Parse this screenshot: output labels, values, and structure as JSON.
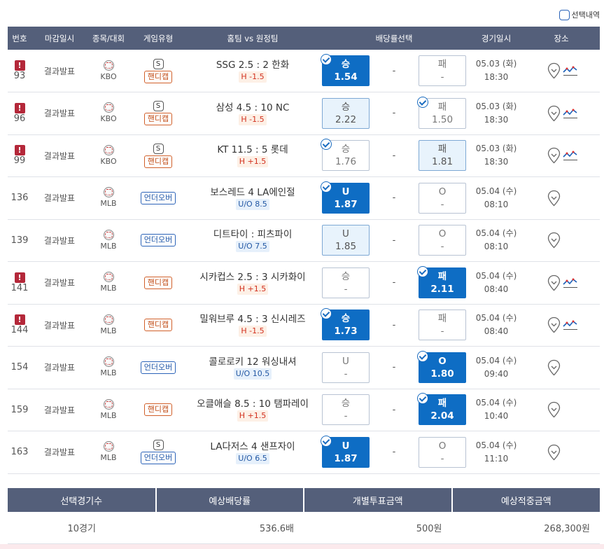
{
  "toggle_label": "선택내역",
  "headers": [
    "번호",
    "마감일시",
    "종목/대회",
    "게임유형",
    "홈팀 vs 원정팀",
    "배당률선택",
    "경기일시",
    "장소"
  ],
  "rows": [
    {
      "warn": "!",
      "num": "93",
      "deadline": "결과발표",
      "league": "KBO",
      "s_badge": "S",
      "type": "핸디캡",
      "type_kind": "handi",
      "home": "SSG 2.5",
      "sep": ":",
      "away": "2 한화",
      "sub": "H -1.5",
      "sub_kind": "red",
      "left": {
        "label": "승",
        "odds": "1.54",
        "state": "sel"
      },
      "mid": "-",
      "right": {
        "label": "패",
        "odds": "-",
        "state": "none"
      },
      "date": "05.03 (화)",
      "time": "18:30",
      "graph": true
    },
    {
      "warn": "!",
      "num": "96",
      "deadline": "결과발표",
      "league": "KBO",
      "s_badge": "S",
      "type": "핸디캡",
      "type_kind": "handi",
      "home": "삼성 4.5",
      "sep": ":",
      "away": "10 NC",
      "sub": "H -1.5",
      "sub_kind": "red",
      "left": {
        "label": "승",
        "odds": "2.22",
        "state": "faint"
      },
      "mid": "-",
      "right": {
        "label": "패",
        "odds": "1.50",
        "state": "chk"
      },
      "date": "05.03 (화)",
      "time": "18:30",
      "graph": true
    },
    {
      "warn": "!",
      "num": "99",
      "deadline": "결과발표",
      "league": "KBO",
      "s_badge": "S",
      "type": "핸디캡",
      "type_kind": "handi",
      "home": "KT 11.5",
      "sep": ":",
      "away": "5 롯데",
      "sub": "H +1.5",
      "sub_kind": "red",
      "left": {
        "label": "승",
        "odds": "1.76",
        "state": "chk"
      },
      "mid": "-",
      "right": {
        "label": "패",
        "odds": "1.81",
        "state": "faint"
      },
      "date": "05.03 (화)",
      "time": "18:30",
      "graph": true
    },
    {
      "warn": "",
      "num": "136",
      "deadline": "결과발표",
      "league": "MLB",
      "s_badge": "",
      "type": "언더오버",
      "type_kind": "uo",
      "home": "보스레드",
      "sep": "4",
      "away": "LA에인절",
      "sub": "U/O 8.5",
      "sub_kind": "blue",
      "left": {
        "label": "U",
        "odds": "1.87",
        "state": "sel"
      },
      "mid": "-",
      "right": {
        "label": "O",
        "odds": "-",
        "state": "none"
      },
      "date": "05.04 (수)",
      "time": "08:10",
      "graph": false
    },
    {
      "warn": "",
      "num": "139",
      "deadline": "결과발표",
      "league": "MLB",
      "s_badge": "",
      "type": "언더오버",
      "type_kind": "uo",
      "home": "디트타이",
      "sep": ":",
      "away": "피츠파이",
      "sub": "U/O 7.5",
      "sub_kind": "blue",
      "left": {
        "label": "U",
        "odds": "1.85",
        "state": "faint"
      },
      "mid": "-",
      "right": {
        "label": "O",
        "odds": "-",
        "state": "none"
      },
      "date": "05.04 (수)",
      "time": "08:10",
      "graph": false
    },
    {
      "warn": "!",
      "num": "141",
      "deadline": "결과발표",
      "league": "MLB",
      "s_badge": "",
      "type": "핸디캡",
      "type_kind": "handi",
      "home": "시카컵스 2.5",
      "sep": ":",
      "away": "3 시카화이",
      "sub": "H +1.5",
      "sub_kind": "red",
      "left": {
        "label": "승",
        "odds": "-",
        "state": "none"
      },
      "mid": "-",
      "right": {
        "label": "패",
        "odds": "2.11",
        "state": "sel"
      },
      "date": "05.04 (수)",
      "time": "08:40",
      "graph": true
    },
    {
      "warn": "!",
      "num": "144",
      "deadline": "결과발표",
      "league": "MLB",
      "s_badge": "",
      "type": "핸디캡",
      "type_kind": "handi",
      "home": "밀워브루 4.5",
      "sep": ":",
      "away": "3 신시레즈",
      "sub": "H -1.5",
      "sub_kind": "red",
      "left": {
        "label": "승",
        "odds": "1.73",
        "state": "sel"
      },
      "mid": "-",
      "right": {
        "label": "패",
        "odds": "-",
        "state": "none"
      },
      "date": "05.04 (수)",
      "time": "08:40",
      "graph": true
    },
    {
      "warn": "",
      "num": "154",
      "deadline": "결과발표",
      "league": "MLB",
      "s_badge": "",
      "type": "언더오버",
      "type_kind": "uo",
      "home": "콜로로키",
      "sep": "12",
      "away": "워싱내셔",
      "sub": "U/O 10.5",
      "sub_kind": "blue",
      "left": {
        "label": "U",
        "odds": "-",
        "state": "none"
      },
      "mid": "-",
      "right": {
        "label": "O",
        "odds": "1.80",
        "state": "sel"
      },
      "date": "05.04 (수)",
      "time": "09:40",
      "graph": false
    },
    {
      "warn": "",
      "num": "159",
      "deadline": "결과발표",
      "league": "MLB",
      "s_badge": "",
      "type": "핸디캡",
      "type_kind": "handi",
      "home": "오클애슬 8.5",
      "sep": ":",
      "away": "10 탬파레이",
      "sub": "H +1.5",
      "sub_kind": "red",
      "left": {
        "label": "승",
        "odds": "-",
        "state": "none"
      },
      "mid": "-",
      "right": {
        "label": "패",
        "odds": "2.04",
        "state": "sel"
      },
      "date": "05.04 (수)",
      "time": "10:40",
      "graph": false
    },
    {
      "warn": "",
      "num": "163",
      "deadline": "결과발표",
      "league": "MLB",
      "s_badge": "S",
      "type": "언더오버",
      "type_kind": "uo",
      "home": "LA다저스",
      "sep": "4",
      "away": "샌프자이",
      "sub": "U/O 6.5",
      "sub_kind": "blue",
      "left": {
        "label": "U",
        "odds": "1.87",
        "state": "sel"
      },
      "mid": "-",
      "right": {
        "label": "O",
        "odds": "-",
        "state": "none"
      },
      "date": "05.04 (수)",
      "time": "11:10",
      "graph": false
    }
  ],
  "summary": {
    "headers": [
      "선택경기수",
      "예상배당률",
      "개별투표금액",
      "예상적중금액"
    ],
    "values": [
      "10경기",
      "536.6배",
      "500원",
      "268,300원"
    ]
  },
  "colors": {
    "header_bg": "#545f7a",
    "selected": "#0e6dc4",
    "handicap": "#d1602a",
    "underover": "#2b63b8",
    "warn": "#b4283a"
  }
}
